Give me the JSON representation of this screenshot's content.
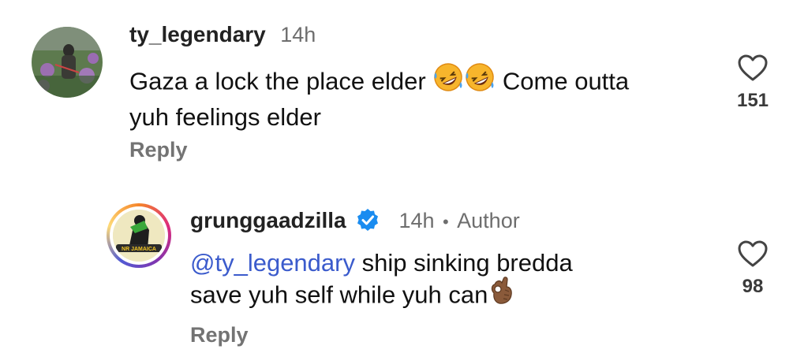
{
  "comments": [
    {
      "username": "ty_legendary",
      "time": "14h",
      "text_line1": "Gaza a lock the place elder ",
      "text_line1_after": " Come outta",
      "text_line2": "yuh feelings elder",
      "emoji": [
        "rolling-on-floor-laughing",
        "rolling-on-floor-laughing"
      ],
      "likes": "151",
      "reply_label": "Reply"
    },
    {
      "username": "grunggaadzilla",
      "verified": true,
      "time": "14h",
      "separator": "•",
      "role": "Author",
      "mention": "@ty_legendary",
      "text_line1": " ship sinking bredda",
      "text_line2": "save yuh self while yuh can",
      "emoji": [
        "ok-hand"
      ],
      "avatar_badge": "NR JAMAICA",
      "likes": "98",
      "reply_label": "Reply"
    }
  ],
  "colors": {
    "verified": "#1a8cf0",
    "mention": "#3b5bcc",
    "secondary": "#6e6e6e"
  },
  "icons": [
    "heart-outline-icon",
    "verified-badge-icon"
  ]
}
